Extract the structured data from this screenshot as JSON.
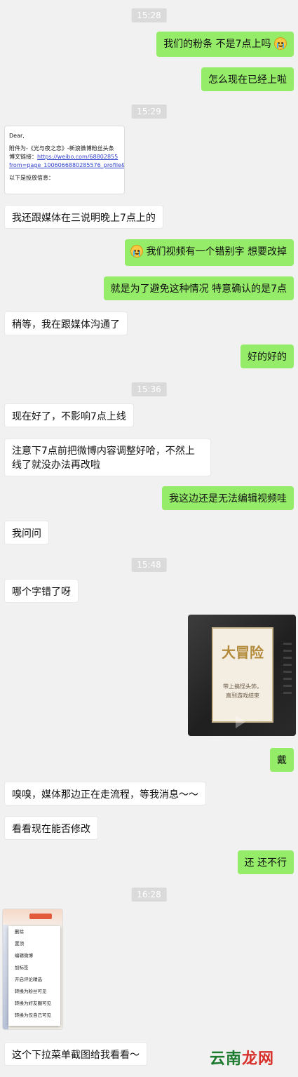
{
  "timestamps": [
    "15:28",
    "15:29",
    "15:36",
    "15:48",
    "16:28"
  ],
  "messages": {
    "m1": "我们的粉条 不是7点上吗",
    "m2": "怎么现在已经上啦",
    "m3": "我还跟媒体在三说明晚上7点上的",
    "m4": "我们视频有一个错别字 想要改掉",
    "m5": "就是为了避免这种情况 特意确认的是7点",
    "m6": "稍等，我在跟媒体沟通了",
    "m7": "好的好的",
    "m8": "现在好了，不影响7点上线",
    "m9": "注意下7点前把微博内容调整好哈，不然上线了就没办法再改啦",
    "m10": "我这边还是无法编辑视频哇",
    "m11": "我问问",
    "m12": "哪个字错了呀",
    "m13": "戴",
    "m14": "嗅嗅，媒体那边正在走流程，等我消息～～",
    "m15": "看看现在能否修改",
    "m16": "还 还不行",
    "m17": "这个下拉菜单截图给我看看～"
  },
  "doc_image": {
    "line1": "Dear,",
    "line2": "附件为-《光与夜之恋》-新浪微博粉丝头条",
    "line3_label": "博文链接：",
    "line3_link": "https://weibo.com/68802855",
    "line4": "from=page_1006066880285576_profile&",
    "line5": "以下是投放信息："
  },
  "video_image": {
    "title": "大冒险",
    "text1": "带上搞怪头饰，",
    "text2": "直到游戏结束"
  },
  "menu_image": {
    "items": [
      "删除",
      "置顶",
      "编辑微博",
      "加标签",
      "开启评论精选",
      "转换为粉丝可见",
      "转换为好友圈可见",
      "转换为仅自己可见"
    ]
  },
  "watermark": {
    "part1": "云南",
    "part2": "龙网"
  },
  "colors": {
    "my_bubble": "#95ec69",
    "other_bubble": "#ffffff",
    "background": "#f1f1f1"
  }
}
